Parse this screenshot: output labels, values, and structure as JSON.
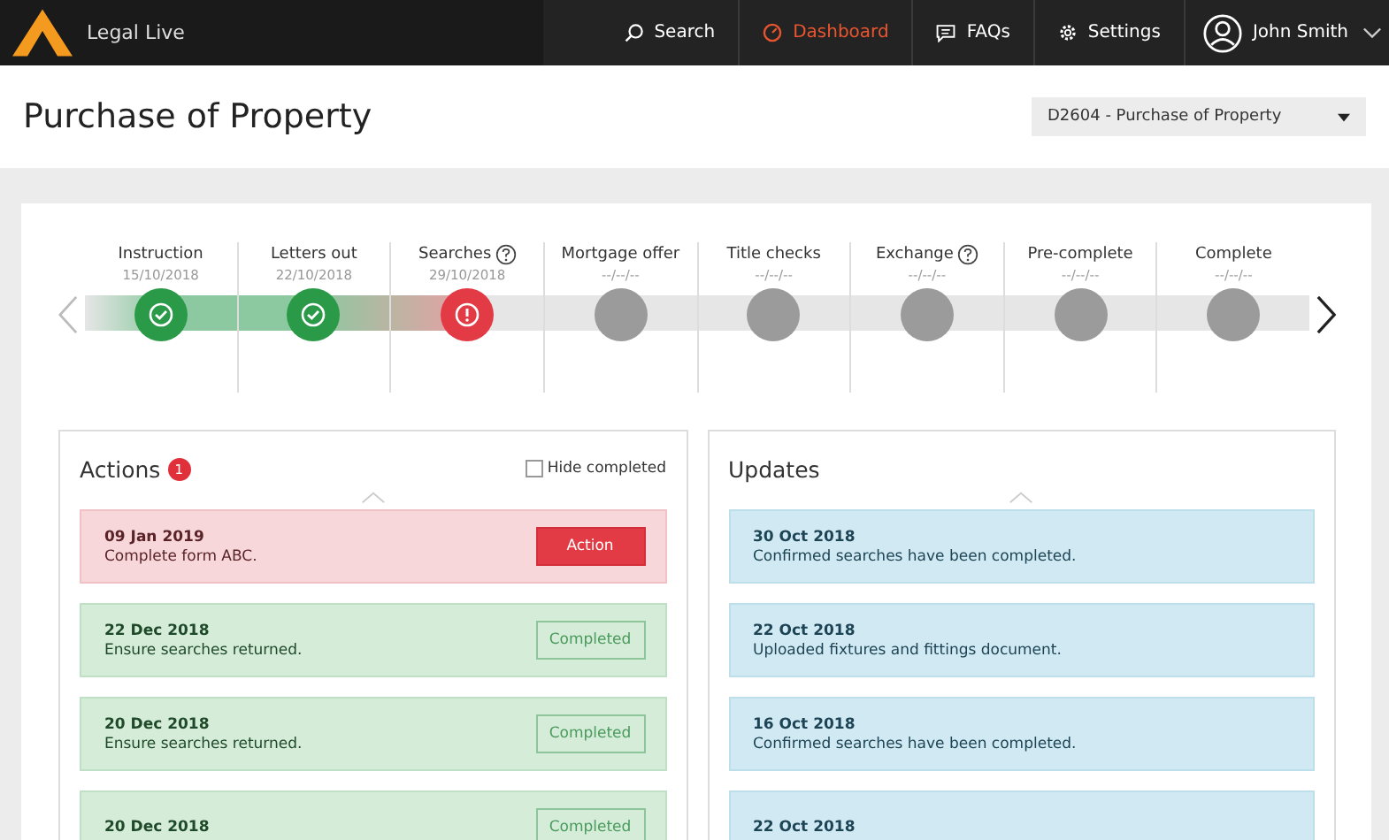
{
  "brand": "Legal Live",
  "nav": [
    {
      "label": "Search",
      "kind": "search",
      "selected": false
    },
    {
      "label": "Dashboard",
      "kind": "dashboard",
      "selected": true
    },
    {
      "label": "FAQs",
      "kind": "faqs",
      "selected": false
    },
    {
      "label": "Settings",
      "kind": "settings",
      "selected": false
    }
  ],
  "user": "John Smith",
  "page_title": "Purchase of Property",
  "matter_select": "D2604 - Purchase of Property",
  "stages": [
    {
      "name": "Instruction",
      "date": "15/10/2018",
      "kind": "done",
      "help": false
    },
    {
      "name": "Letters out",
      "date": "22/10/2018",
      "kind": "done",
      "help": false
    },
    {
      "name": "Searches",
      "date": "29/10/2018",
      "kind": "error",
      "help": true
    },
    {
      "name": "Mortgage offer",
      "date": "--/--/--",
      "kind": "pending",
      "help": false
    },
    {
      "name": "Title checks",
      "date": "--/--/--",
      "kind": "pending",
      "help": false
    },
    {
      "name": "Exchange",
      "date": "--/--/--",
      "kind": "pending",
      "help": true
    },
    {
      "name": "Pre-complete",
      "date": "--/--/--",
      "kind": "pending",
      "help": false
    },
    {
      "name": "Complete",
      "date": "--/--/--",
      "kind": "pending",
      "help": false
    }
  ],
  "actions": {
    "title": "Actions",
    "badge": "1",
    "hide_completed": {
      "label": "Hide completed",
      "checked": false
    },
    "items": [
      {
        "date": "09 Jan 2019",
        "text": "Complete form ABC.",
        "kind": "due",
        "button": "Action"
      },
      {
        "date": "22 Dec 2018",
        "text": "Ensure searches returned.",
        "kind": "completed",
        "button": "Completed"
      },
      {
        "date": "20 Dec 2018",
        "text": "Ensure searches returned.",
        "kind": "completed",
        "button": "Completed"
      },
      {
        "date": "20 Dec 2018",
        "kind": "completed",
        "button": "Completed"
      }
    ]
  },
  "updates": {
    "title": "Updates",
    "items": [
      {
        "date": "30 Oct 2018",
        "text": "Confirmed searches have been completed."
      },
      {
        "date": "22 Oct 2018",
        "text": "Uploaded fixtures and fittings document."
      },
      {
        "date": "16 Oct 2018",
        "text": "Confirmed searches have been completed."
      },
      {
        "date": "22 Oct 2018"
      }
    ]
  }
}
